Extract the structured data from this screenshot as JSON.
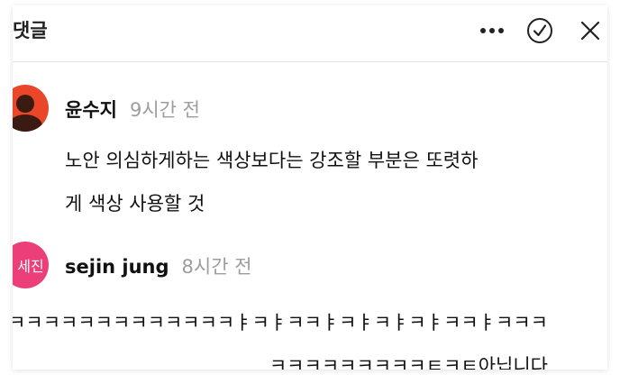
{
  "header": {
    "title": "댓글"
  },
  "comments": [
    {
      "author": "윤수지",
      "time": "9시간 전",
      "text_lines": [
        "노안 의심하게하는 색상보다는 강조할 부분은 또렷하",
        "게 색상 사용할 것"
      ]
    },
    {
      "author": "sejin jung",
      "avatar_text": "세진",
      "time": "8시간 전",
      "text_lines": [
        "ㅋㅋㅋㅋㅋㅋㅋㅋㅋㅋㅋㅋㅋㅑㅋㅑㅋㅋㅑㅋㅑㅋㅑㅋㅑㅋㅋㅑㅋㅋㅋ",
        "..ㅋㅋㅋㅋㅋㅋㅋㅋㅋㅌㅋㅌ아닙니다"
      ]
    }
  ],
  "colors": {
    "avatar_photo_bg": "#e9462a",
    "avatar_text_bg": "#ec3f7a",
    "time_text": "#9d9d9d"
  },
  "icons": {
    "more": "more-horizontal-icon",
    "check": "check-circle-icon",
    "close": "close-icon"
  }
}
